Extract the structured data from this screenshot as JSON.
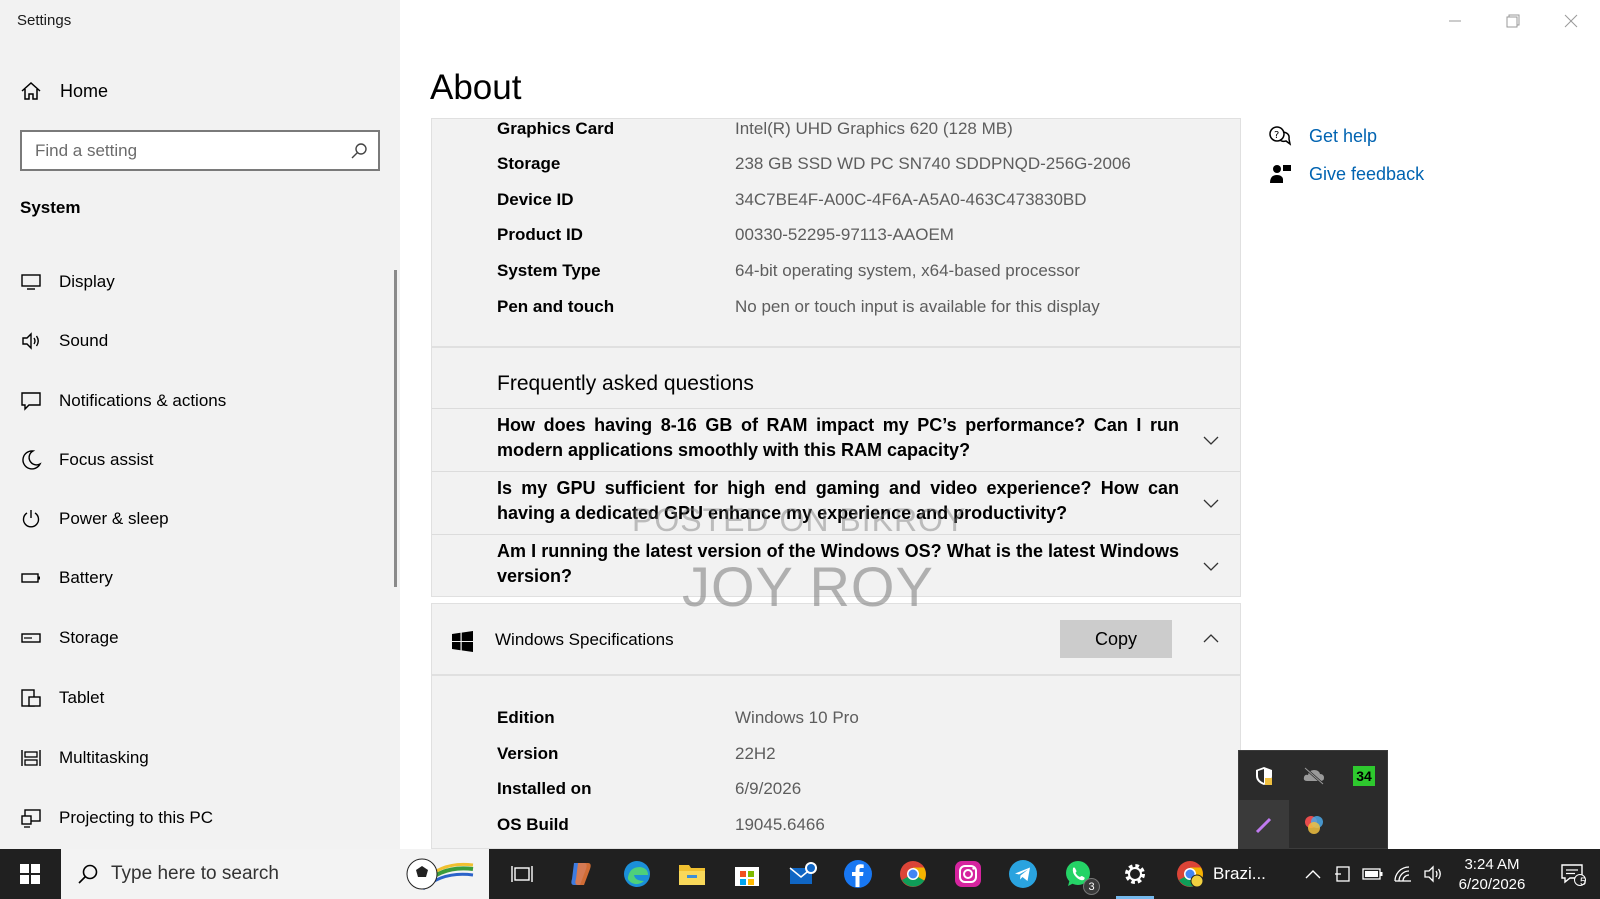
{
  "window": {
    "title": "Settings"
  },
  "sidebar": {
    "home_label": "Home",
    "search_placeholder": "Find a setting",
    "section_title": "System",
    "items": [
      {
        "label": "Display",
        "icon": "display-icon"
      },
      {
        "label": "Sound",
        "icon": "speaker-icon"
      },
      {
        "label": "Notifications & actions",
        "icon": "notification-icon"
      },
      {
        "label": "Focus assist",
        "icon": "moon-icon"
      },
      {
        "label": "Power & sleep",
        "icon": "power-icon"
      },
      {
        "label": "Battery",
        "icon": "battery-icon"
      },
      {
        "label": "Storage",
        "icon": "storage-icon"
      },
      {
        "label": "Tablet",
        "icon": "tablet-icon"
      },
      {
        "label": "Multitasking",
        "icon": "multitasking-icon"
      },
      {
        "label": "Projecting to this PC",
        "icon": "projecting-icon"
      }
    ]
  },
  "main": {
    "title": "About",
    "device_specs": [
      {
        "key": "Graphics Card",
        "value": "Intel(R) UHD Graphics 620 (128 MB)"
      },
      {
        "key": "Storage",
        "value": "238 GB SSD WD PC SN740 SDDPNQD-256G-2006"
      },
      {
        "key": "Device ID",
        "value": "34C7BE4F-A00C-4F6A-A5A0-463C473830BD"
      },
      {
        "key": "Product ID",
        "value": "00330-52295-97113-AAOEM"
      },
      {
        "key": "System Type",
        "value": "64-bit operating system, x64-based processor"
      },
      {
        "key": "Pen and touch",
        "value": "No pen or touch input is available for this display"
      }
    ],
    "faq": {
      "title": "Frequently asked questions",
      "items": [
        {
          "question": "How does having 8-16 GB of RAM impact my PC’s performance? Can I run modern applications smoothly with this RAM capacity?"
        },
        {
          "question": "Is my GPU sufficient for high end gaming and video experience? How can having a dedicated GPU enhance my experience and productivity?"
        },
        {
          "question": "Am I running the latest version of the Windows OS? What is the latest Windows version?"
        }
      ]
    },
    "windows_specs": {
      "title": "Windows Specifications",
      "copy_label": "Copy",
      "rows": [
        {
          "key": "Edition",
          "value": "Windows 10 Pro"
        },
        {
          "key": "Version",
          "value": "22H2"
        },
        {
          "key": "Installed on",
          "value": "6/9/2026"
        },
        {
          "key": "OS Build",
          "value": "19045.6466"
        }
      ]
    },
    "related": {
      "get_help": "Get help",
      "give_feedback": "Give feedback"
    }
  },
  "watermark": {
    "line1": "POSTED ON BIKROY",
    "line2": "JOY ROY"
  },
  "tray_popup": {
    "badge_number": "34"
  },
  "taskbar": {
    "search_placeholder": "Type here to search",
    "whatsapp_badge": "3",
    "brazil_label": "Brazi...",
    "time": "3:24 AM",
    "date": "6/20/2026",
    "notification_count": "5"
  },
  "colors": {
    "link": "#0063b1",
    "sidebar_bg": "#f2f2f2",
    "taskbar_bg": "#202020"
  }
}
